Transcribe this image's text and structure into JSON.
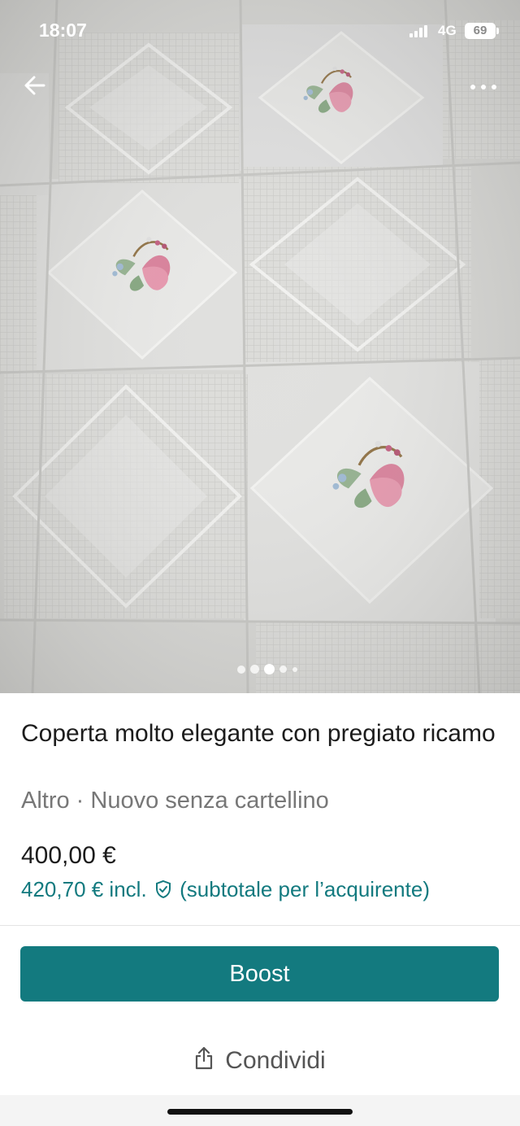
{
  "status_bar": {
    "time": "18:07",
    "network": "4G",
    "battery": "69"
  },
  "gallery": {
    "dots": 5,
    "active_dot": 2,
    "image_description_icon": "photo"
  },
  "listing": {
    "title": "Coperta molto elegante con pregiato ricamo",
    "subtitle": "Altro · Nuovo senza cartellino",
    "price": "400,00 €",
    "price_incl": "420,70 € incl.",
    "price_note": "(subtotale per l’acquirente)"
  },
  "actions": {
    "boost_label": "Boost",
    "share_label": "Condividi"
  },
  "colors": {
    "accent": "#137a7f"
  },
  "icons": [
    "back-arrow-icon",
    "more-icon",
    "shield-check-icon",
    "share-icon"
  ]
}
